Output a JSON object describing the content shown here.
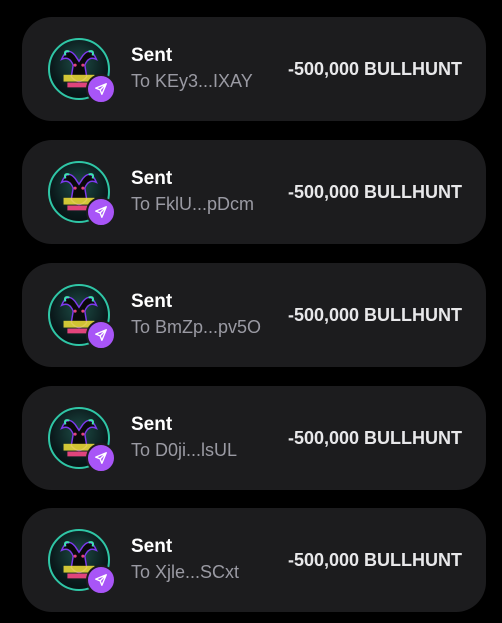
{
  "colors": {
    "background": "#000000",
    "card": "#1c1c1e",
    "badge": "#a855f7",
    "title": "#ffffff",
    "subtitle": "#9a9aa3"
  },
  "transactions": [
    {
      "status": "Sent",
      "recipient": "To KEy3...IXAY",
      "amount": "-500,000 BULLHUNT",
      "icon": "send-icon"
    },
    {
      "status": "Sent",
      "recipient": "To FklU...pDcm",
      "amount": "-500,000 BULLHUNT",
      "icon": "send-icon"
    },
    {
      "status": "Sent",
      "recipient": "To BmZp...pv5O",
      "amount": "-500,000 BULLHUNT",
      "icon": "send-icon"
    },
    {
      "status": "Sent",
      "recipient": "To D0ji...lsUL",
      "amount": "-500,000 BULLHUNT",
      "icon": "send-icon"
    },
    {
      "status": "Sent",
      "recipient": "To Xjle...SCxt",
      "amount": "-500,000 BULLHUNT",
      "icon": "send-icon"
    }
  ]
}
